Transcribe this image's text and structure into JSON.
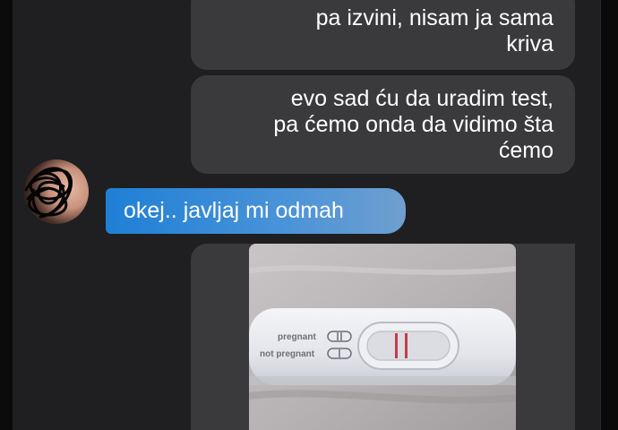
{
  "conversation": {
    "messages": [
      {
        "side": "received",
        "text_lines": [
          "pa izvini, nisam ja sama",
          "kriva"
        ]
      },
      {
        "side": "received",
        "text_lines": [
          "evo sad ću da uradim test,",
          "pa ćemo onda da vidimo šta",
          "ćemo"
        ]
      },
      {
        "side": "sent",
        "text": "okej.. javljaj mi odmah"
      }
    ],
    "photo": {
      "label_pregnant": "pregnant",
      "label_not_pregnant": "not pregnant"
    }
  },
  "colors": {
    "background": "#1f1f21",
    "received_bubble": "#3a3a3c",
    "sent_bubble_start": "#1f7fd6",
    "sent_bubble_end": "#6f9fcf",
    "text": "#ffffff"
  },
  "icons": {
    "avatar": "scribbled-avatar-icon"
  }
}
